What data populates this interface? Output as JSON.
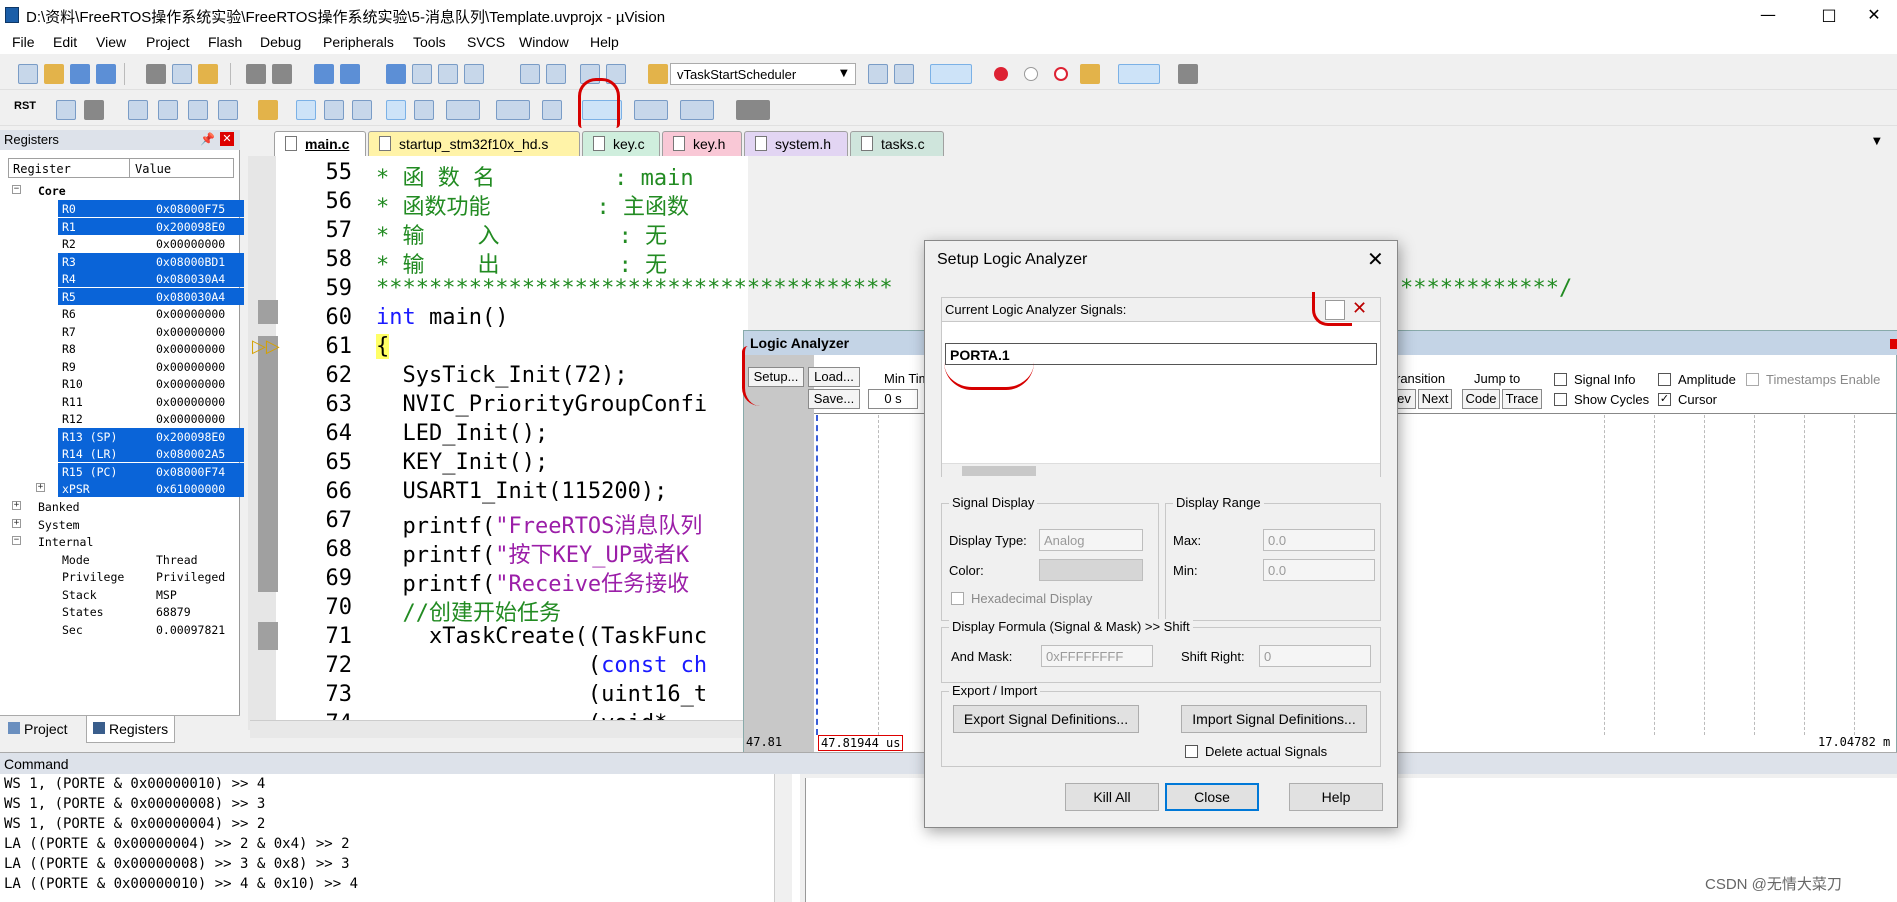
{
  "window": {
    "title": "D:\\资料\\FreeRTOS操作系统实验\\FreeRTOS操作系统实验\\5-消息队列\\Template.uvprojx - µVision",
    "minimize": "—",
    "maximize": "□",
    "close": "✕"
  },
  "menu": [
    "File",
    "Edit",
    "View",
    "Project",
    "Flash",
    "Debug",
    "Peripherals",
    "Tools",
    "SVCS",
    "Window",
    "Help"
  ],
  "toolbar": {
    "function_combo": "vTaskStartScheduler",
    "rst_label": "RST"
  },
  "registers": {
    "panel_title": "Registers",
    "col_register": "Register",
    "col_value": "Value",
    "core_label": "Core",
    "rows": [
      {
        "name": "R0",
        "value": "0x08000F75"
      },
      {
        "name": "R1",
        "value": "0x200098E0"
      },
      {
        "name": "R2",
        "value": "0x00000000"
      },
      {
        "name": "R3",
        "value": "0x08000BD1"
      },
      {
        "name": "R4",
        "value": "0x080030A4"
      },
      {
        "name": "R5",
        "value": "0x080030A4"
      },
      {
        "name": "R6",
        "value": "0x00000000"
      },
      {
        "name": "R7",
        "value": "0x00000000"
      },
      {
        "name": "R8",
        "value": "0x00000000"
      },
      {
        "name": "R9",
        "value": "0x00000000"
      },
      {
        "name": "R10",
        "value": "0x00000000"
      },
      {
        "name": "R11",
        "value": "0x00000000"
      },
      {
        "name": "R12",
        "value": "0x00000000"
      },
      {
        "name": "R13 (SP)",
        "value": "0x200098E0"
      },
      {
        "name": "R14 (LR)",
        "value": "0x080002A5"
      },
      {
        "name": "R15 (PC)",
        "value": "0x08000F74"
      },
      {
        "name": "xPSR",
        "value": "0x61000000"
      }
    ],
    "banked_label": "Banked",
    "system_label": "System",
    "internal_label": "Internal",
    "internal_rows": [
      {
        "name": "Mode",
        "value": "Thread"
      },
      {
        "name": "Privilege",
        "value": "Privileged"
      },
      {
        "name": "Stack",
        "value": "MSP"
      },
      {
        "name": "States",
        "value": "68879"
      },
      {
        "name": "Sec",
        "value": "0.00097821"
      }
    ],
    "tab_project": "Project",
    "tab_registers": "Registers"
  },
  "tabs": [
    {
      "label": "main.c",
      "color": "#ffffff"
    },
    {
      "label": "startup_stm32f10x_hd.s",
      "color": "#fff3a8"
    },
    {
      "label": "key.c",
      "color": "#cfeedd"
    },
    {
      "label": "key.h",
      "color": "#f9c8d6"
    },
    {
      "label": "system.h",
      "color": "#e2d5f3"
    },
    {
      "label": "tasks.c",
      "color": "#cfe5dc"
    }
  ],
  "editor": {
    "lines": [
      {
        "num": "55",
        "text": "* 函 数 名         : main"
      },
      {
        "num": "56",
        "text": "* 函数功能        : 主函数"
      },
      {
        "num": "57",
        "text": "* 输    入         : 无"
      },
      {
        "num": "58",
        "text": "* 输    出         : 无"
      },
      {
        "num": "59",
        "text": "***************************************"
      },
      {
        "num": "60",
        "text_kw": "int",
        "text": " main()"
      },
      {
        "num": "61",
        "text": "{"
      },
      {
        "num": "62",
        "text": "  SysTick_Init(72);"
      },
      {
        "num": "63",
        "text": "  NVIC_PriorityGroupConfi"
      },
      {
        "num": "64",
        "text": "  LED_Init();"
      },
      {
        "num": "65",
        "text": "  KEY_Init();"
      },
      {
        "num": "66",
        "text": "  USART1_Init(115200);"
      },
      {
        "num": "67",
        "text_a": "  printf(",
        "text_s": "\"FreeRTOS消息队列"
      },
      {
        "num": "68",
        "text_a": "  printf(",
        "text_s": "\"按下KEY_UP或者K"
      },
      {
        "num": "69",
        "text_a": "  printf(",
        "text_s": "\"Receive任务接收"
      },
      {
        "num": "70",
        "text": "  //创建开始任务"
      },
      {
        "num": "71",
        "text": "    xTaskCreate((TaskFunc"
      },
      {
        "num": "72",
        "text_a": "                (",
        "text_kw": "const ch"
      },
      {
        "num": "73",
        "text": "                (uint16_t"
      },
      {
        "num": "74",
        "text": "                (void*"
      }
    ],
    "line59_tail": "************/"
  },
  "logic_analyzer": {
    "title": "Logic Analyzer",
    "setup": "Setup...",
    "load": "Load...",
    "save": "Save...",
    "min_time": "Min Tim",
    "min_time_value": "0 s",
    "transition": "ransition",
    "prev": "ev",
    "next": "Next",
    "jump_to": "Jump to",
    "code": "Code",
    "trace": "Trace",
    "signal_info": "Signal Info",
    "show_cycles": "Show Cycles",
    "amplitude": "Amplitude",
    "cursor": "Cursor",
    "timestamps": "Timestamps Enable",
    "time_left": "47.81",
    "time_cursor": "47.81944 us",
    "time_right": "17.04782 m"
  },
  "command": {
    "title": "Command",
    "lines": [
      "WS 1, (PORTE & 0x00000010) >> 4",
      "WS 1, (PORTE & 0x00000008) >> 3",
      "WS 1, (PORTE & 0x00000004) >> 2",
      "LA ((PORTE & 0x00000004) >> 2 & 0x4) >> 2",
      "LA ((PORTE & 0x00000008) >> 3 & 0x8) >> 3",
      "LA ((PORTE & 0x00000010) >> 4 & 0x10) >> 4"
    ]
  },
  "dialog": {
    "title": "Setup Logic Analyzer",
    "close": "✕",
    "signals_label": "Current Logic Analyzer Signals:",
    "signal_entry": "PORTA.1",
    "signal_display": "Signal Display",
    "display_type_label": "Display Type:",
    "display_type_value": "Analog",
    "color_label": "Color:",
    "hex_display": "Hexadecimal Display",
    "display_range": "Display Range",
    "max_label": "Max:",
    "max_value": "0.0",
    "min_label": "Min:",
    "min_value": "0.0",
    "formula": "Display Formula (Signal & Mask) >> Shift",
    "and_mask_label": "And Mask:",
    "and_mask_value": "0xFFFFFFFF",
    "shift_right_label": "Shift Right:",
    "shift_right_value": "0",
    "export_import": "Export / Import",
    "export_btn": "Export Signal Definitions...",
    "import_btn": "Import Signal Definitions...",
    "delete_signals": "Delete actual Signals",
    "kill_all": "Kill All",
    "close_btn": "Close",
    "help": "Help"
  },
  "watermark": "CSDN @无情大菜刀"
}
